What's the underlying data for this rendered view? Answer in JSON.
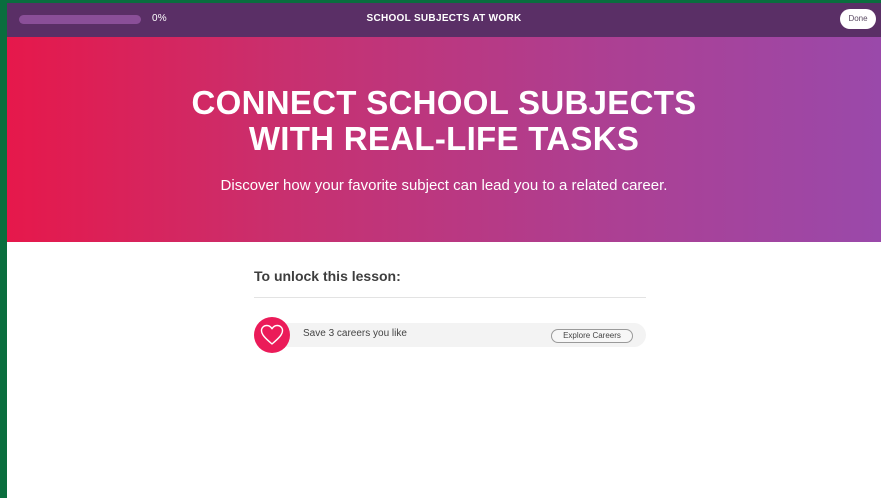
{
  "topbar": {
    "progress_percent": 0,
    "progress_label": "0%",
    "title": "SCHOOL SUBJECTS AT WORK",
    "done_label": "Done"
  },
  "hero": {
    "title_line1": "CONNECT SCHOOL SUBJECTS",
    "title_line2": "WITH REAL-LIFE TASKS",
    "subtitle": "Discover how your favorite subject can lead you to a related career."
  },
  "unlock": {
    "heading": "To unlock this lesson:",
    "tasks": [
      {
        "icon": "heart-icon",
        "label": "Save 3 careers you like",
        "action_label": "Explore Careers"
      }
    ]
  },
  "colors": {
    "topbar": "#5a2f66",
    "hero_gradient_start": "#e6184b",
    "hero_gradient_end": "#9a49aa",
    "heart_circle": "#eb1b59",
    "outer_frame": "#0a6e3e"
  }
}
